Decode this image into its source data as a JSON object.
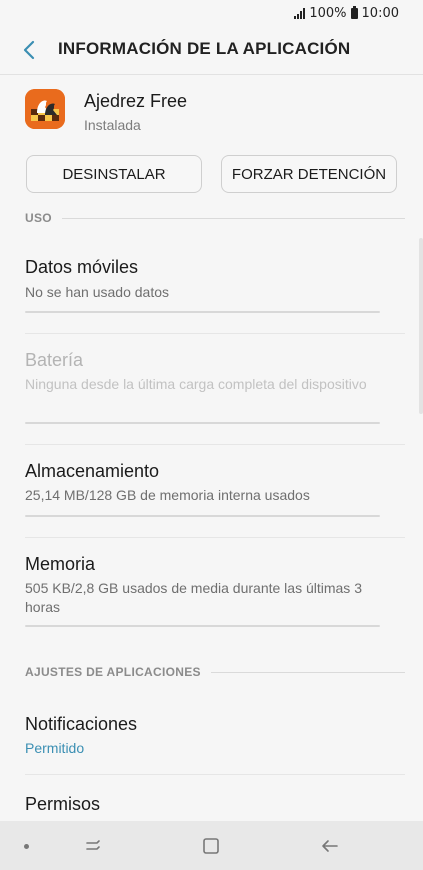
{
  "status_bar": {
    "battery": "100%",
    "time": "10:00"
  },
  "header": {
    "title": "INFORMACIÓN DE LA APLICACIÓN"
  },
  "app": {
    "name": "Ajedrez Free",
    "status": "Instalada"
  },
  "buttons": {
    "uninstall": "DESINSTALAR",
    "force_stop": "FORZAR DETENCIÓN"
  },
  "sections": {
    "usage": "USO",
    "app_settings": "AJUSTES DE APLICACIONES"
  },
  "items": {
    "mobile_data": {
      "title": "Datos móviles",
      "subtitle": "No se han usado datos"
    },
    "battery": {
      "title": "Batería",
      "subtitle": "Ninguna desde la última carga completa del dispositivo"
    },
    "storage": {
      "title": "Almacenamiento",
      "subtitle": "25,14 MB/128 GB de memoria interna usados"
    },
    "memory": {
      "title": "Memoria",
      "subtitle": "505 KB/2,8 GB usados de media durante las últimas 3 horas"
    },
    "notifications": {
      "title": "Notificaciones",
      "subtitle": "Permitido"
    },
    "permissions": {
      "title": "Permisos"
    }
  },
  "colors": {
    "accent": "#3b8fb3",
    "app_icon": "#e96b1d"
  }
}
